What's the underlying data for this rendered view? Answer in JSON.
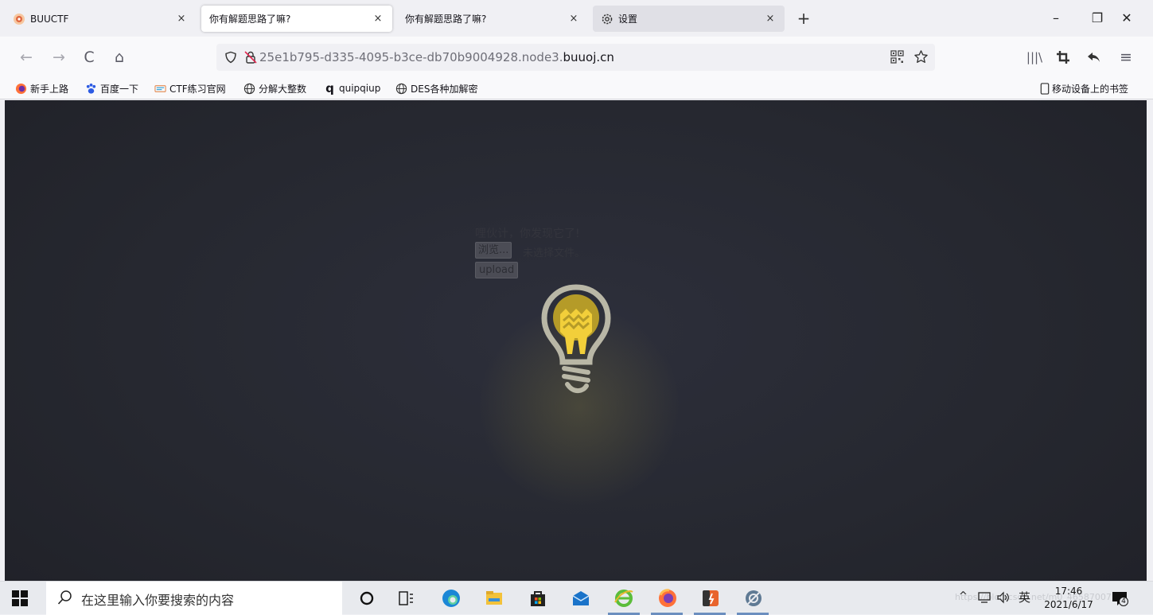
{
  "tabs": [
    {
      "title": "BUUCTF",
      "close": "×"
    },
    {
      "title": "你有解题思路了嘛?",
      "close": "×"
    },
    {
      "title": "你有解题思路了嘛?",
      "close": "×"
    },
    {
      "title": "设置",
      "close": "×"
    }
  ],
  "new_tab": "+",
  "window_controls": {
    "minimize": "–",
    "restore": "❐",
    "close": "✕"
  },
  "nav": {
    "back": "←",
    "forward": "→",
    "reload": "C",
    "home": "⌂",
    "url_prefix": "25e1b795-d335-4095-b3ce-db70b9004928.node3.",
    "url_domain": "buuoj.cn"
  },
  "toolbar_right": {
    "library": "|||\\",
    "menu": "≡"
  },
  "bookmarks": [
    {
      "label": "新手上路",
      "icon": "firefox-icon"
    },
    {
      "label": "百度一下",
      "icon": "baidu-paw-icon"
    },
    {
      "label": "CTF练习官网",
      "icon": "ctf-icon"
    },
    {
      "label": "分解大整数",
      "icon": "globe-icon"
    },
    {
      "label": "quipqiup",
      "icon": "q-icon"
    },
    {
      "label": "DES各种加解密",
      "icon": "globe-icon"
    }
  ],
  "mobile_bookmarks": "移动设备上的书签",
  "page": {
    "message": "哩伙计，你发现它了!",
    "browse_button": "浏览...",
    "no_file": "未选择文件。",
    "upload_button": "upload"
  },
  "taskbar": {
    "search_placeholder": "在这里输入你要搜索的内容",
    "ime": "英",
    "time": "17:46",
    "date": "2021/6/17",
    "watermark": "https://blog.csdn.net/m0_46587007",
    "notification_count": "4"
  },
  "colors": {
    "firefox_orange": "#ff7139",
    "page_bg": "#262830",
    "bulb_yellow": "#f2cf3a",
    "bulb_gray": "#b9b7a6"
  }
}
